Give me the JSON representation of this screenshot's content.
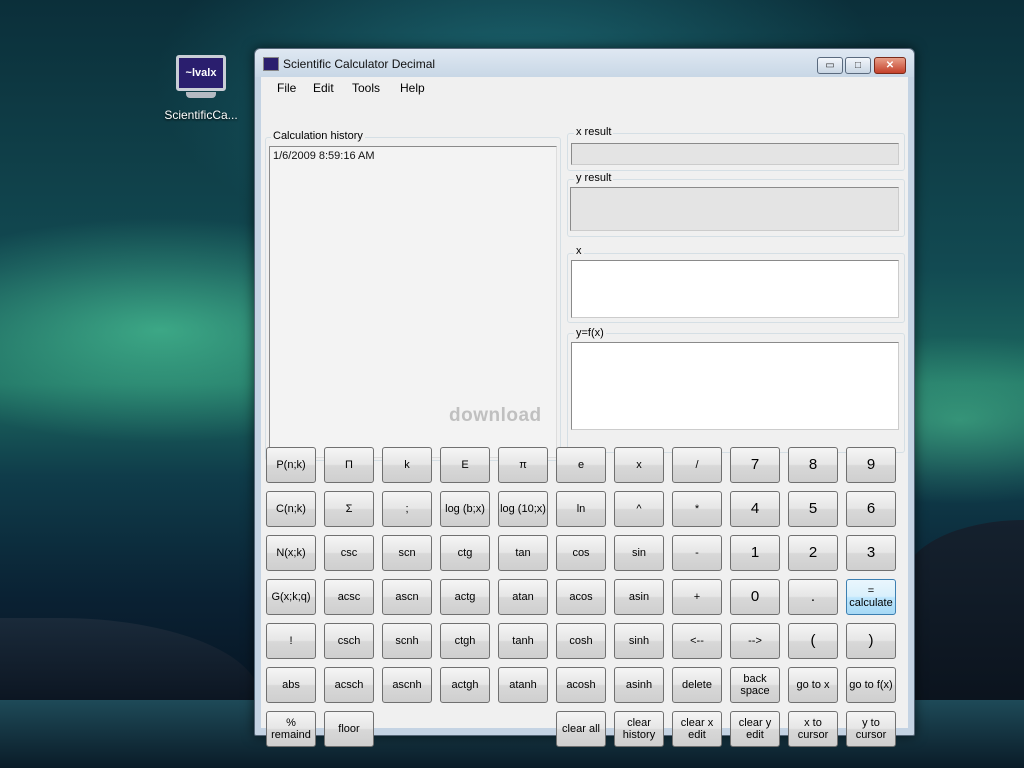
{
  "desktop": {
    "icon_label": "ScientificCa...",
    "icon_logo_text": "~lvalx"
  },
  "window": {
    "title": "Scientific Calculator Decimal",
    "minimize": "▭",
    "maximize": "□",
    "close": "✕"
  },
  "menu": [
    "File",
    "Edit",
    "Tools",
    "Help"
  ],
  "history": {
    "label": "Calculation history",
    "entries": [
      "1/6/2009 8:59:16 AM"
    ]
  },
  "fields": {
    "x_result": "x result",
    "y_result": "y result",
    "x": "x",
    "y": "y=f(x)"
  },
  "watermark": "download",
  "buttons": [
    [
      "P(n;k)",
      "Π",
      "k",
      "E",
      "π",
      "e",
      "x",
      "/",
      "7",
      "8",
      "9"
    ],
    [
      "C(n;k)",
      "Σ",
      ";",
      "log (b;x)",
      "log (10;x)",
      "ln",
      "^",
      "*",
      "4",
      "5",
      "6"
    ],
    [
      "N(x;k)",
      "csc",
      "scn",
      "ctg",
      "tan",
      "cos",
      "sin",
      "-",
      "1",
      "2",
      "3"
    ],
    [
      "G(x;k;q)",
      "acsc",
      "ascn",
      "actg",
      "atan",
      "acos",
      "asin",
      "+",
      "0",
      ".",
      "= calculate"
    ],
    [
      "!",
      "csch",
      "scnh",
      "ctgh",
      "tanh",
      "cosh",
      "sinh",
      "<--",
      "-->",
      "(",
      ")"
    ],
    [
      "abs",
      "acsch",
      "ascnh",
      "actgh",
      "atanh",
      "acosh",
      "asinh",
      "delete",
      "back space",
      "go to x",
      "go to f(x)"
    ],
    [
      "% remaind",
      "floor",
      "",
      "",
      "",
      "clear all",
      "clear history",
      "clear x edit",
      "clear y edit",
      "x to cursor",
      "y to cursor"
    ]
  ]
}
